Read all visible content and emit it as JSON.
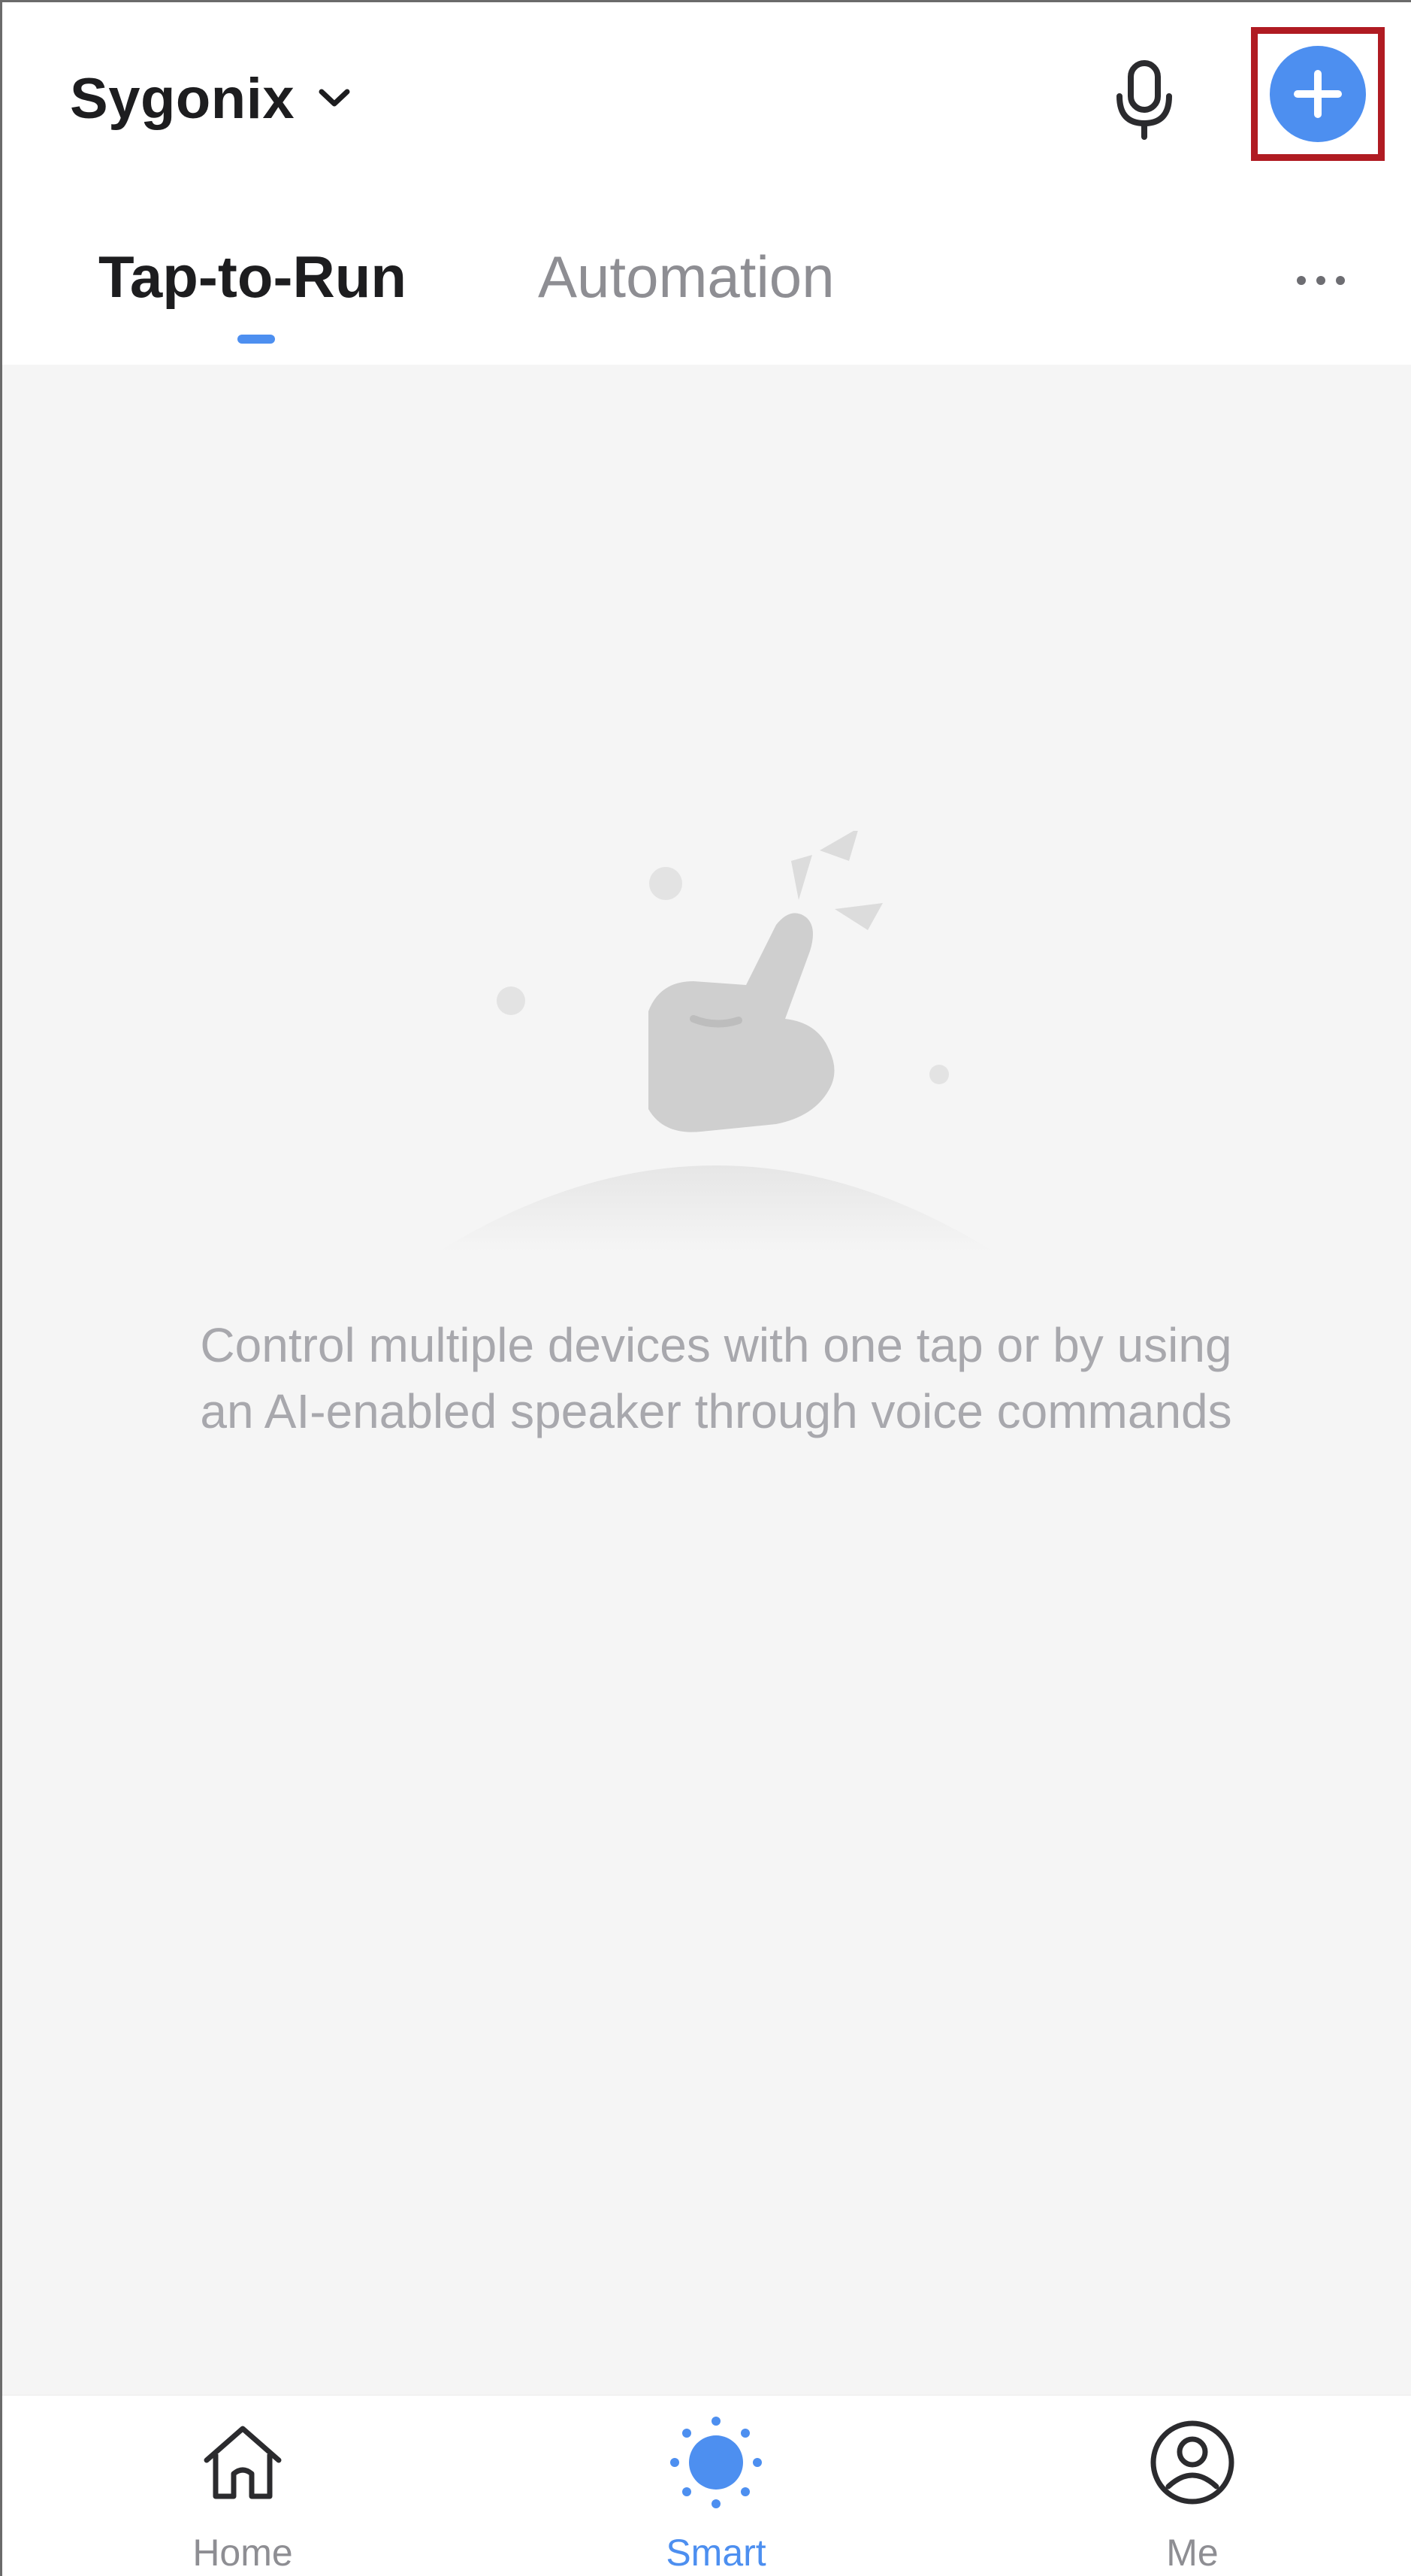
{
  "header": {
    "home_name": "Sygonix",
    "home_chevron_icon": "chevron-down-icon",
    "mic_icon": "microphone-icon",
    "add_icon": "plus-circle-icon",
    "add_highlighted": true,
    "highlight_color": "#b01b22"
  },
  "tabs": {
    "items": [
      {
        "label": "Tap-to-Run",
        "active": true
      },
      {
        "label": "Automation",
        "active": false
      }
    ],
    "more_icon": "more-horizontal-icon"
  },
  "empty_state": {
    "illustration": "tap-hand-illustration",
    "message_line1": "Control multiple devices with one tap or by using",
    "message_line2": "an AI-enabled speaker through voice commands"
  },
  "bottom_nav": {
    "items": [
      {
        "label": "Home",
        "icon": "home-icon",
        "active": false
      },
      {
        "label": "Smart",
        "icon": "sun-icon",
        "active": true
      },
      {
        "label": "Me",
        "icon": "user-circle-icon",
        "active": false
      }
    ]
  },
  "colors": {
    "accent": "#4d8ff0",
    "text_primary": "#1d1d1f",
    "text_secondary": "#8e8e93",
    "content_bg": "#f5f5f5"
  }
}
